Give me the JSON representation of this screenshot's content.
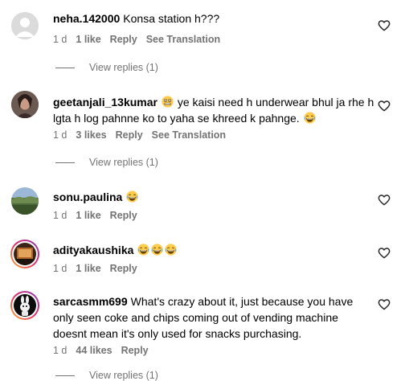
{
  "comments": [
    {
      "user": "neha.142000",
      "text": "Konsa station h???",
      "time": "1 d",
      "likes": "1 like",
      "reply": "Reply",
      "translate": "See Translation",
      "view_replies": "View replies (1)"
    },
    {
      "user": "geetanjali_13kumar",
      "text": "ye kaisi need h underwear bhul ja rhe h lgta h log pahnne ko to yaha se khreed k pahnge.",
      "time": "1 d",
      "likes": "3 likes",
      "reply": "Reply",
      "translate": "See Translation",
      "view_replies": "View replies (1)"
    },
    {
      "user": "sonu.paulina",
      "text": "",
      "time": "1 d",
      "likes": "1 like",
      "reply": "Reply"
    },
    {
      "user": "adityakaushika",
      "text": "",
      "time": "1 d",
      "likes": "1 like",
      "reply": "Reply"
    },
    {
      "user": "sarcasmm699",
      "text": "What's crazy about it, just because you have only seen coke and chips coming out of vending machine doesnt mean it's only used for snacks purchasing.",
      "time": "1 d",
      "likes": "44 likes",
      "reply": "Reply",
      "view_replies": "View replies (1)"
    }
  ],
  "icons": {
    "like": "heart-outline-icon",
    "emoji_laugh": "laughing-emoji-icon",
    "emoji_grimace": "grimacing-emoji-icon"
  },
  "colors": {
    "meta": "#737373",
    "text": "#000000"
  }
}
